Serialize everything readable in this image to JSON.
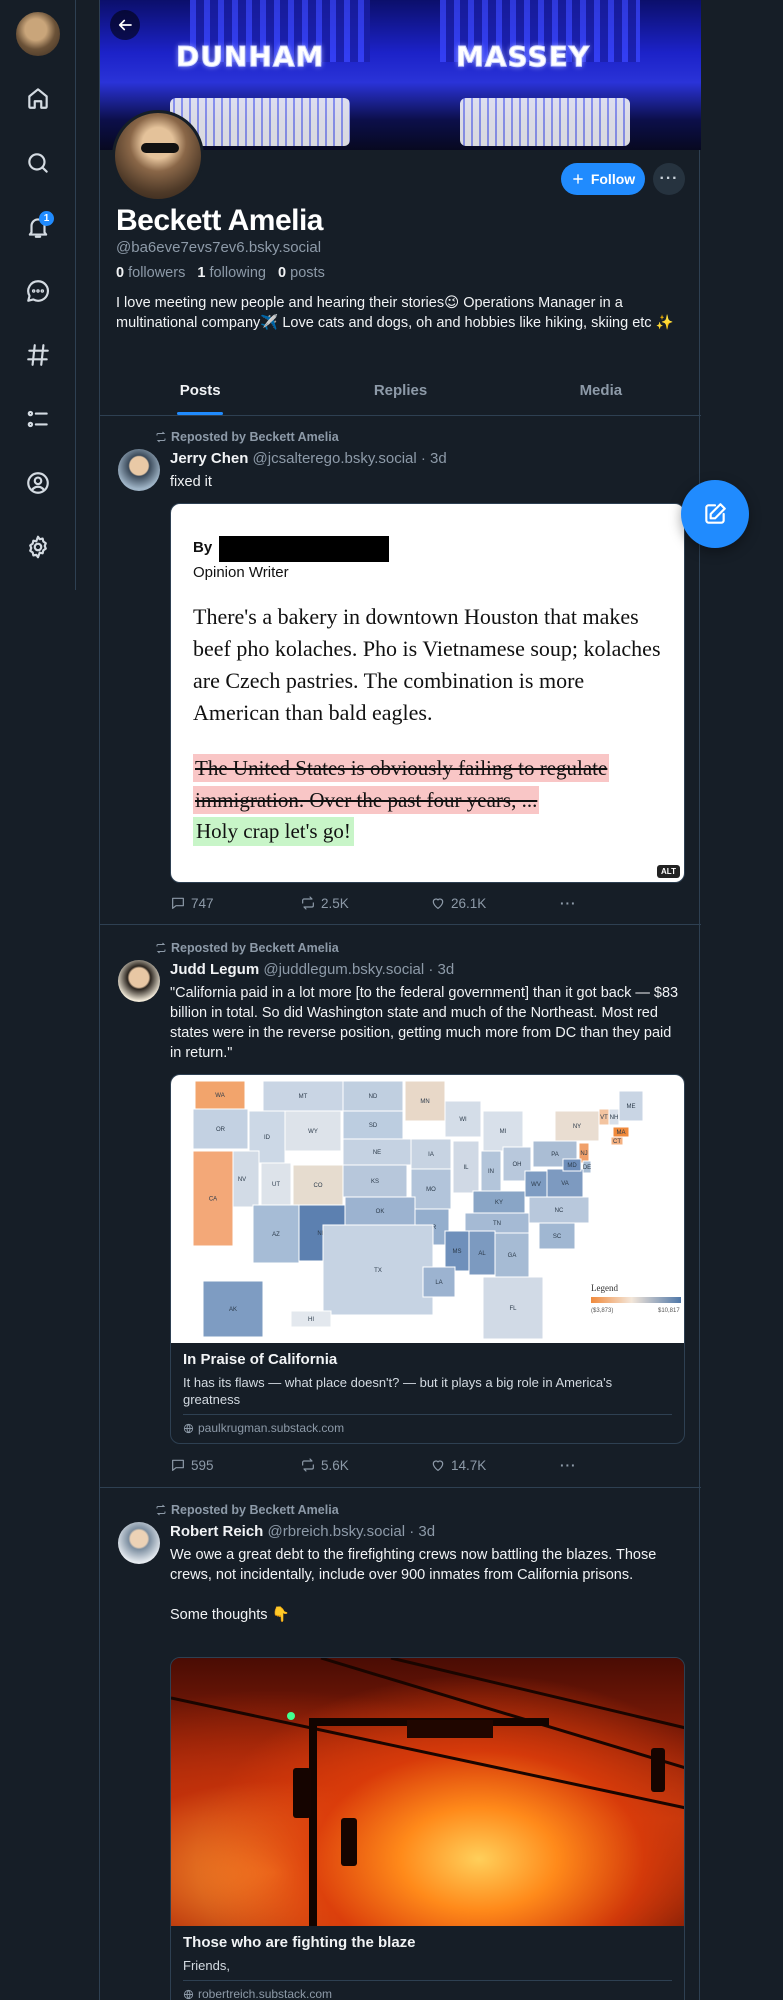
{
  "profile": {
    "display_name": "Beckett Amelia",
    "handle": "@ba6eve7evs7ev6.bsky.social",
    "followers_count": "0",
    "followers_label": "followers",
    "following_count": "1",
    "following_label": "following",
    "posts_count": "0",
    "posts_label": "posts",
    "bio": "I love meeting new people and hearing their stories😉 Operations Manager in a multinational company✈️ Love cats and dogs, oh and hobbies like hiking, skiing etc ✨",
    "follow_label": "Follow",
    "more_label": "···",
    "banner_sign_left": "DUNHAM",
    "banner_sign_right": "MASSEY"
  },
  "nav": {
    "notifications_badge": "1",
    "items": [
      "home-icon",
      "search-icon",
      "bell-icon",
      "chat-icon",
      "hashtag-icon",
      "list-icon",
      "profile-icon",
      "gear-icon"
    ]
  },
  "tabs": [
    {
      "label": "Posts",
      "active": true
    },
    {
      "label": "Replies",
      "active": false
    },
    {
      "label": "Media",
      "active": false
    }
  ],
  "posts": [
    {
      "repost_label": "Reposted by Beckett Amelia",
      "author_name": "Jerry Chen",
      "author_meta": "@jcsalterego.bsky.social · 3d",
      "text": "fixed it",
      "image": {
        "by_label": "By",
        "role": "Opinion Writer",
        "body": "There's a bakery in downtown Houston that makes beef pho kolaches. Pho is Vietnamese soup; kolaches are Czech pastries. The combination is more American than bald eagles.",
        "struck": "The United States is obviously failing to regulate immigration. Over the past four years, ...",
        "green": "Holy crap let's go!",
        "alt_badge": "ALT"
      },
      "replies": "747",
      "reposts": "2.5K",
      "likes": "26.1K"
    },
    {
      "repost_label": "Reposted by Beckett Amelia",
      "author_name": "Judd Legum",
      "author_meta": "@juddlegum.bsky.social · 3d",
      "text": "\"California paid in a lot more [to the federal government] than it got back — $83 billion in total. So did Washington state and much of the Northeast. Most red states were in the reverse position, getting much more from DC than they paid in return.\"",
      "map": {
        "legend_title": "Legend",
        "legend_min": "($3,873)",
        "legend_max": "$10,817",
        "states": [
          "WA",
          "MT",
          "ND",
          "MN",
          "OR",
          "ID",
          "SD",
          "WI",
          "MI",
          "NY",
          "VT",
          "NH",
          "ME",
          "MA",
          "CT",
          "WY",
          "IA",
          "NE",
          "NV",
          "UT",
          "IL",
          "IN",
          "OH",
          "PA",
          "NJ",
          "CA",
          "CO",
          "KS",
          "MO",
          "KY",
          "WV",
          "VA",
          "MD",
          "DE",
          "AZ",
          "NM",
          "OK",
          "AR",
          "TN",
          "NC",
          "SC",
          "MS",
          "AL",
          "GA",
          "TX",
          "LA",
          "FL",
          "AK",
          "HI"
        ]
      },
      "link_title": "In Praise of California",
      "link_desc": "It has its flaws — what place doesn't? — but it plays a big role in America's greatness",
      "link_domain": "paulkrugman.substack.com",
      "replies": "595",
      "reposts": "5.6K",
      "likes": "14.7K"
    },
    {
      "repost_label": "Reposted by Beckett Amelia",
      "author_name": "Robert Reich",
      "author_meta": "@rbreich.bsky.social · 3d",
      "text": "We owe a great debt to the firefighting crews now battling the blazes. Those crews, not incidentally, include over 900 inmates from California prisons.\n\nSome thoughts 👇",
      "link_title": "Those who are fighting the blaze",
      "link_desc": "Friends,",
      "link_domain": "robertreich.substack.com"
    }
  ],
  "colors": {
    "background": "#161e27",
    "accent": "#208bfe",
    "muted_text": "#8d9aa8",
    "border": "#2e4052"
  }
}
